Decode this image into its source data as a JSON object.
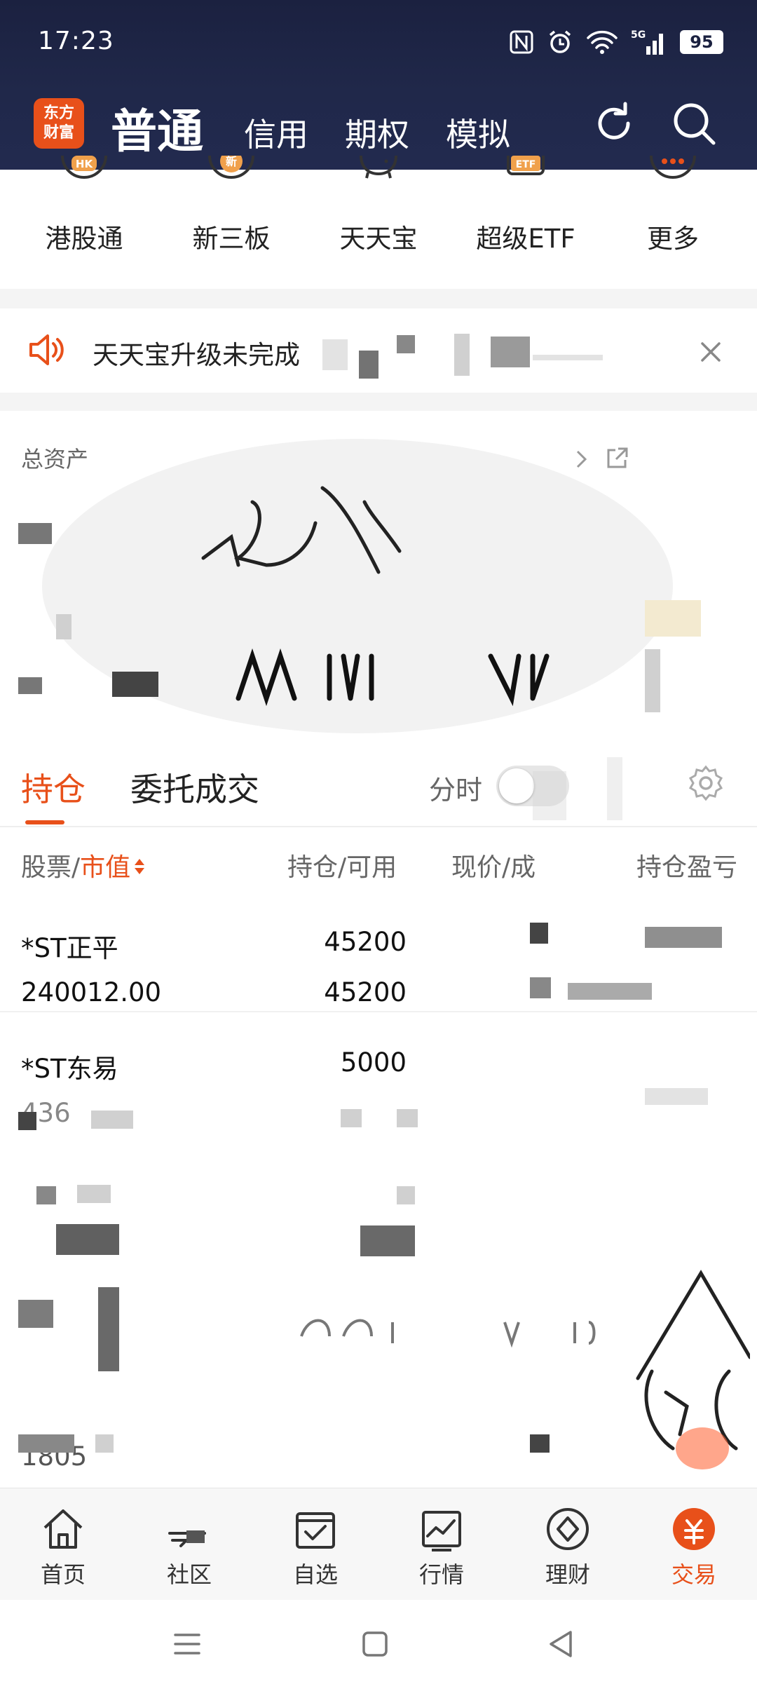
{
  "status_bar": {
    "time": "17:23",
    "battery": "95",
    "network": "5G"
  },
  "header": {
    "logo_line1": "东方",
    "logo_line2": "财富",
    "tabs": [
      {
        "label": "普通",
        "active": true
      },
      {
        "label": "信用",
        "active": false
      },
      {
        "label": "期权",
        "active": false
      },
      {
        "label": "模拟",
        "active": false
      }
    ]
  },
  "quick_entries": [
    {
      "label": "港股通",
      "icon": "hk-icon",
      "icon_text": "HK"
    },
    {
      "label": "新三板",
      "icon": "new-board-icon",
      "icon_text": "新"
    },
    {
      "label": "天天宝",
      "icon": "piggy-bank-icon",
      "icon_text": ""
    },
    {
      "label": "超级ETF",
      "icon": "etf-icon",
      "icon_text": "ETF"
    },
    {
      "label": "更多",
      "icon": "more-icon",
      "icon_text": "···"
    }
  ],
  "notice": {
    "text": "天天宝升级未完成"
  },
  "assets": {
    "title": "总资产"
  },
  "positions": {
    "tabs": [
      {
        "label": "持仓",
        "active": true
      },
      {
        "label": "委托成交",
        "active": false
      }
    ],
    "toggle_label": "分时",
    "columns": {
      "name_a": "股票/",
      "name_b": "市值",
      "hold": "持仓/可用",
      "price": "现价/成",
      "pl": "持仓盈亏"
    },
    "rows": [
      {
        "name": "*ST正平",
        "market_value": "240012.00",
        "hold": "45200",
        "available": "45200"
      },
      {
        "name": "*ST东易",
        "market_value": "436",
        "hold": "5000",
        "available": ""
      },
      {
        "name": "",
        "market_value": "",
        "hold": "",
        "available": ""
      },
      {
        "name": "",
        "market_value": "1805",
        "hold": "",
        "available": ""
      }
    ]
  },
  "tabbar": [
    {
      "label": "首页",
      "icon": "home-icon",
      "active": false
    },
    {
      "label": "社区",
      "icon": "community-icon",
      "active": false
    },
    {
      "label": "自选",
      "icon": "watchlist-icon",
      "active": false
    },
    {
      "label": "行情",
      "icon": "market-icon",
      "active": false
    },
    {
      "label": "理财",
      "icon": "wealth-icon",
      "active": false
    },
    {
      "label": "交易",
      "icon": "trade-icon",
      "active": true
    }
  ],
  "colors": {
    "accent": "#e8501a",
    "header_bg": "#1b2140",
    "text": "#222222",
    "muted": "#666666"
  }
}
